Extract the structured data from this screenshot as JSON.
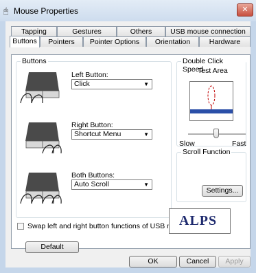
{
  "window": {
    "title": "Mouse Properties",
    "close_glyph": "✕"
  },
  "tabs_back": [
    "Tapping",
    "Gestures",
    "Others",
    "USB mouse connection"
  ],
  "tabs_front": [
    "Buttons",
    "Pointers",
    "Pointer Options",
    "Orientation",
    "Hardware"
  ],
  "buttons_group": {
    "title": "Buttons",
    "left": {
      "label": "Left Button:",
      "value": "Click"
    },
    "right": {
      "label": "Right Button:",
      "value": "Shortcut Menu"
    },
    "both": {
      "label": "Both Buttons:",
      "value": "Auto Scroll"
    }
  },
  "double_click": {
    "title": "Double Click Speed",
    "test_area": "Test Area",
    "slow": "Slow",
    "fast": "Fast"
  },
  "scroll": {
    "title": "Scroll Function",
    "settings": "Settings..."
  },
  "swap_checkbox": {
    "label": "Swap left and right button functions of USB mouse",
    "checked": false
  },
  "default_button": "Default",
  "brand": {
    "logo_text": "ALPS"
  },
  "footer": {
    "ok": "OK",
    "cancel": "Cancel",
    "apply": "Apply"
  }
}
